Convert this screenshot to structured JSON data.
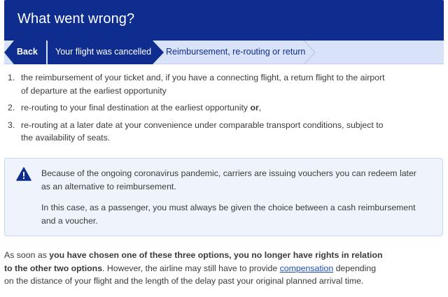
{
  "colors": {
    "header_bg": "#0f2d8f",
    "breadcrumb_bg": "#d8e2f8",
    "link": "#1b4bb5",
    "notice_bg": "#eef3fc"
  },
  "header": {
    "title": "What went wrong?"
  },
  "breadcrumb": {
    "back_label": "Back",
    "step1_label": "Your flight was cancelled",
    "step2_label": "Reimbursement, re-routing or return"
  },
  "options": [
    {
      "num": "1.",
      "text_line1": "the reimbursement of your ticket and, if you have a connecting flight, a return flight to the airport",
      "text_line2": "of departure at the earliest opportunity"
    },
    {
      "num": "2.",
      "text_main": "re-routing to your final destination at the earliest opportunity ",
      "text_bold": "or",
      "text_end": ","
    },
    {
      "num": "3.",
      "text_line1": "re-routing at a later date at your convenience under comparable transport conditions, subject to",
      "text_line2": "the availability of seats."
    }
  ],
  "notice": {
    "icon": "warning-icon",
    "p1_line1": "Because of the ongoing coronavirus pandemic, carriers are issuing vouchers you can redeem later",
    "p1_line2": "as an alternative to reimbursement.",
    "p2_line1": "In this case, as a passenger, you must always be given the choice between a cash reimbursement",
    "p2_line2": "and a voucher."
  },
  "footer": {
    "part1": "As soon as ",
    "bold1": "you have chosen one of these three options, you no longer have rights in relation",
    "bold2": "to the other two options",
    "part2": ". However, the airline may still have to provide ",
    "link": "compensation",
    "part3": " depending",
    "line3": "on the distance of your flight and the length of the delay past your original planned arrival time."
  }
}
